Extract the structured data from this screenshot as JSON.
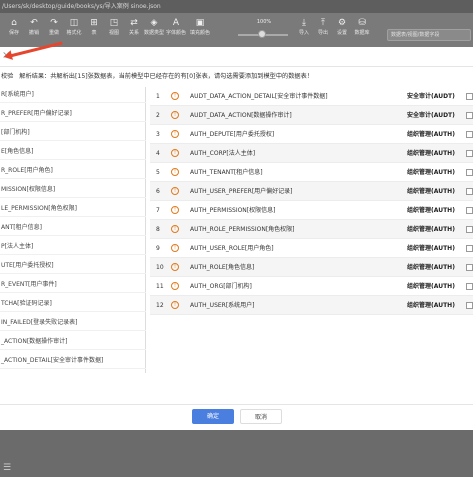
{
  "window": {
    "title": "/Users/sk/desktop/guide/books/ys/导入案例 sinoe.json"
  },
  "toolbar": {
    "items": [
      {
        "icon": "save-icon",
        "glyph": "⌂",
        "label": "保存"
      },
      {
        "icon": "undo-icon",
        "glyph": "↶",
        "label": "撤销"
      },
      {
        "icon": "redo-icon",
        "glyph": "↷",
        "label": "重做"
      },
      {
        "icon": "format-icon",
        "glyph": "◫",
        "label": "格式化"
      },
      {
        "icon": "table-icon",
        "glyph": "⊞",
        "label": "表"
      },
      {
        "icon": "view-icon",
        "glyph": "◳",
        "label": "视图"
      },
      {
        "icon": "relation-icon",
        "glyph": "⇄",
        "label": "关系"
      },
      {
        "icon": "domain-icon",
        "glyph": "◈",
        "label": "数据类型"
      },
      {
        "icon": "font-icon",
        "glyph": "A",
        "label": "字体颜色"
      },
      {
        "icon": "bg-icon",
        "glyph": "▣",
        "label": "填充颜色"
      }
    ],
    "zoom": {
      "label": "100%",
      "value": 50
    },
    "right_items": [
      {
        "icon": "import-icon",
        "glyph": "⤓",
        "label": "导入"
      },
      {
        "icon": "export-icon",
        "glyph": "⤒",
        "label": "导出"
      },
      {
        "icon": "settings-icon",
        "glyph": "⚙",
        "label": "设置"
      },
      {
        "icon": "database-icon",
        "glyph": "⛁",
        "label": "数据库"
      }
    ],
    "search": {
      "placeholder": "数据表/视图/数据字段"
    }
  },
  "dialog": {
    "result_prefix": "校验",
    "result_text": "解析结果：共解析出[15]张数据表，当前模型中已经存在的有[0]张表，请勾选需要添加到模型中的数据表！",
    "left_rows": [
      "R[系统用户]",
      "R_PREFER[用户偏好记录]",
      "[部门机构]",
      "E[角色信息]",
      "R_ROLE[用户角色]",
      "MISSION[权限信息]",
      "LE_PERMISSION[角色权限]",
      "ANT[租户信息]",
      "P[法人主体]",
      "UTE[用户委托授权]",
      "R_EVENT[用户事件]",
      "TCHA[验证码记录]",
      "IN_FAILED[登录失败记录表]",
      "_ACTION[数据操作审计]",
      "_ACTION_DETAIL[安全审计事件数据]"
    ],
    "rows": [
      {
        "num": "1",
        "name": "AUDT_DATA_ACTION_DETAIL[安全审计事件数据]",
        "group": "安全审计(AUDT)"
      },
      {
        "num": "2",
        "name": "AUDT_DATA_ACTION[数据操作审计]",
        "group": "安全审计(AUDT)"
      },
      {
        "num": "3",
        "name": "AUTH_DEPUTE[用户委托授权]",
        "group": "组织管理(AUTH)"
      },
      {
        "num": "4",
        "name": "AUTH_CORP[法人主体]",
        "group": "组织管理(AUTH)"
      },
      {
        "num": "5",
        "name": "AUTH_TENANT[租户信息]",
        "group": "组织管理(AUTH)"
      },
      {
        "num": "6",
        "name": "AUTH_USER_PREFER[用户偏好记录]",
        "group": "组织管理(AUTH)"
      },
      {
        "num": "7",
        "name": "AUTH_PERMISSION[权限信息]",
        "group": "组织管理(AUTH)"
      },
      {
        "num": "8",
        "name": "AUTH_ROLE_PERMISSION[角色权限]",
        "group": "组织管理(AUTH)"
      },
      {
        "num": "9",
        "name": "AUTH_USER_ROLE[用户角色]",
        "group": "组织管理(AUTH)"
      },
      {
        "num": "10",
        "name": "AUTH_ROLE[角色信息]",
        "group": "组织管理(AUTH)"
      },
      {
        "num": "11",
        "name": "AUTH_ORG[部门机构]",
        "group": "组织管理(AUTH)"
      },
      {
        "num": "12",
        "name": "AUTH_USER[系统用户]",
        "group": "组织管理(AUTH)"
      }
    ],
    "ok_label": "确定",
    "cancel_label": "取消"
  }
}
